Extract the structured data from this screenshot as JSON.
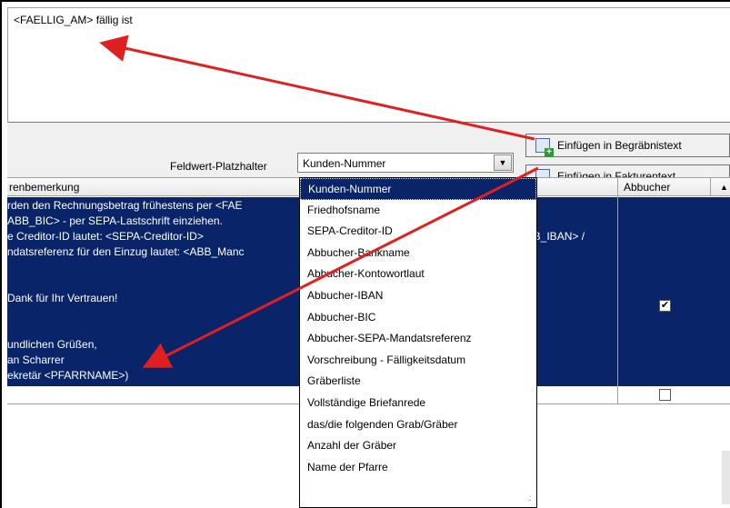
{
  "top_text": "<FAELLIG_AM> fällig ist",
  "placeholder": {
    "label": "Feldwert-Platzhalter",
    "selected": "Kunden-Nummer"
  },
  "buttons": {
    "insert_burial": "Einfügen in Begräbnistext",
    "insert_invoice": "Einfügen in Fakturentext"
  },
  "grid": {
    "header_left": "renbemerkung",
    "header_right": "Abbucher",
    "row_left_lines": [
      "rden den Rechnungsbetrag frühestens per <FAE",
      "ABB_BIC> - per SEPA-Lastschrift einziehen.",
      "e Creditor-ID lautet: <SEPA-Creditor-ID>",
      "ndatsreferenz für den Einzug lautet: <ABB_Manc",
      "",
      " Dank für Ihr Vertrauen!",
      "",
      "undlichen Grüßen,",
      "an Scharrer",
      "ekretär <PFARRNAME>)"
    ],
    "row_right_fragment": "3B_IBAN> /",
    "row1_abbucher": true,
    "row2_abbucher": false
  },
  "dropdown_items": [
    "Kunden-Nummer",
    "Friedhofsname",
    "SEPA-Creditor-ID",
    "Abbucher-Bankname",
    "Abbucher-Kontowortlaut",
    "Abbucher-IBAN",
    "Abbucher-BIC",
    "Abbucher-SEPA-Mandatsreferenz",
    "Vorschreibung - Fälligkeitsdatum",
    "Gräberliste",
    "Vollständige Briefanrede",
    "das/die folgenden Grab/Gräber",
    "Anzahl der Gräber",
    "Name der Pfarre"
  ],
  "colors": {
    "selection": "#0a246a",
    "annotation_arrow": "#e02020"
  },
  "icons": {
    "combo_button": "chevron-down-icon",
    "insert_icon": "document-add-icon",
    "checkbox_checked": "check-icon"
  }
}
